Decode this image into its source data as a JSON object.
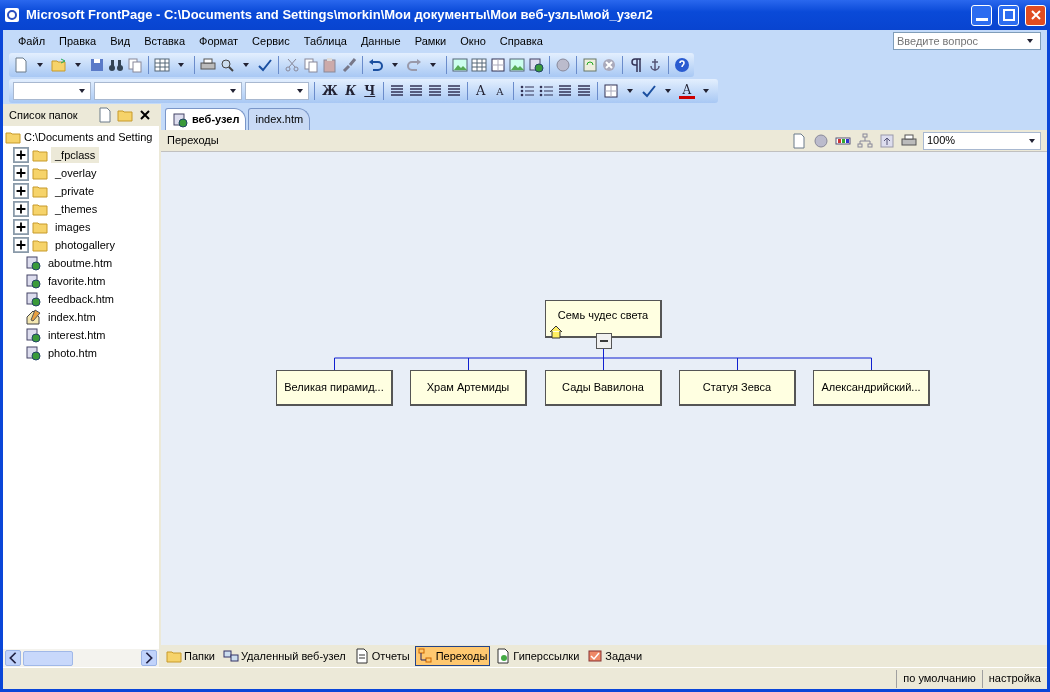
{
  "window": {
    "title": "Microsoft FrontPage - C:\\Documents and Settings\\morkin\\Мои документы\\Мои веб-узлы\\мой_узел2"
  },
  "menu": [
    "Файл",
    "Правка",
    "Вид",
    "Вставка",
    "Формат",
    "Сервис",
    "Таблица",
    "Данные",
    "Рамки",
    "Окно",
    "Справка"
  ],
  "help_search": {
    "placeholder": "Введите вопрос"
  },
  "zoom_field": {
    "value": "100%"
  },
  "format_buttons": [
    {
      "label": "Ж",
      "kind": "bold"
    },
    {
      "label": "К",
      "kind": "italic"
    },
    {
      "label": "Ч",
      "kind": "underline"
    },
    {
      "label": "A",
      "kind": "grow"
    },
    {
      "label": "A",
      "kind": "shrink"
    },
    {
      "label": "A",
      "kind": "color"
    }
  ],
  "folder_pane": {
    "title": "Список папок",
    "root": "C:\\Documents and Setting",
    "items": [
      {
        "label": "_fpclass",
        "kind": "folder",
        "expanded": false,
        "selected": true
      },
      {
        "label": "_overlay",
        "kind": "folder",
        "expanded": false,
        "selected": false
      },
      {
        "label": "_private",
        "kind": "folder",
        "expanded": false,
        "selected": false
      },
      {
        "label": "_themes",
        "kind": "folder",
        "expanded": false,
        "selected": false
      },
      {
        "label": "images",
        "kind": "folder",
        "expanded": false,
        "selected": false
      },
      {
        "label": "photogallery",
        "kind": "folder",
        "expanded": false,
        "selected": false
      },
      {
        "label": "aboutme.htm",
        "kind": "page",
        "selected": false
      },
      {
        "label": "favorite.htm",
        "kind": "page",
        "selected": false
      },
      {
        "label": "feedback.htm",
        "kind": "page",
        "selected": false
      },
      {
        "label": "index.htm",
        "kind": "home",
        "selected": false
      },
      {
        "label": "interest.htm",
        "kind": "page",
        "selected": false
      },
      {
        "label": "photo.htm",
        "kind": "page",
        "selected": false
      }
    ]
  },
  "tabs": [
    {
      "label": "веб-узел",
      "selected": true
    },
    {
      "label": "index.htm",
      "selected": false
    }
  ],
  "view_title": "Переходы",
  "navigation": {
    "label": "Семь чудес света",
    "expanded": true,
    "children": [
      {
        "label": "Великая пирамид..."
      },
      {
        "label": "Храм Артемиды"
      },
      {
        "label": "Сады Вавилона"
      },
      {
        "label": "Статуя Зевса"
      },
      {
        "label": "Александрийский..."
      }
    ]
  },
  "views": [
    {
      "label": "Папки",
      "selected": false
    },
    {
      "label": "Удаленный веб-узел",
      "selected": false
    },
    {
      "label": "Отчеты",
      "selected": false
    },
    {
      "label": "Переходы",
      "selected": true
    },
    {
      "label": "Гиперссылки",
      "selected": false
    },
    {
      "label": "Задачи",
      "selected": false
    }
  ],
  "status_bar": [
    "по умолчанию",
    "настройка"
  ]
}
